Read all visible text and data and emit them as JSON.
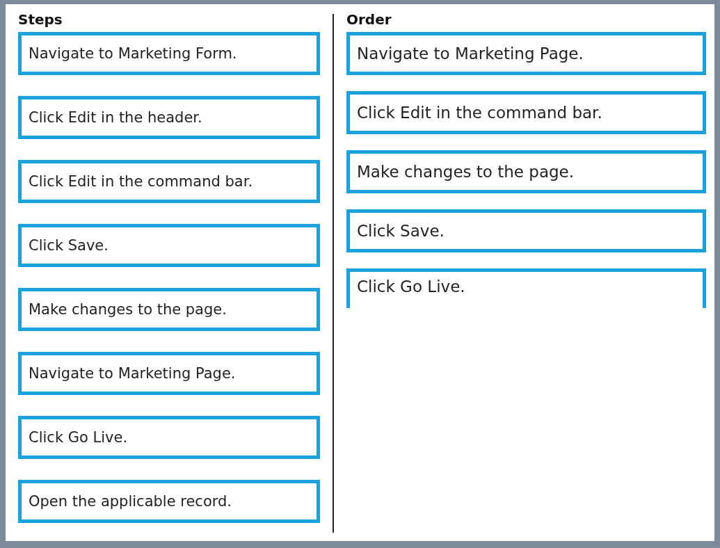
{
  "steps": {
    "title": "Steps",
    "items": [
      {
        "label": "Navigate to Marketing Form."
      },
      {
        "label": "Click Edit in the header."
      },
      {
        "label": "Click Edit in the command bar."
      },
      {
        "label": "Click Save."
      },
      {
        "label": "Make changes to the page."
      },
      {
        "label": "Navigate to Marketing Page."
      },
      {
        "label": "Click Go Live."
      },
      {
        "label": "Open the applicable record."
      }
    ]
  },
  "order": {
    "title": "Order",
    "items": [
      {
        "label": "Navigate to Marketing Page.",
        "kind": "box"
      },
      {
        "label": "Click Edit in the command bar.",
        "kind": "box"
      },
      {
        "label": "Make changes to the page.",
        "kind": "box"
      },
      {
        "label": "Click Save.",
        "kind": "box"
      },
      {
        "label": "Click Go Live.",
        "kind": "open"
      }
    ]
  }
}
